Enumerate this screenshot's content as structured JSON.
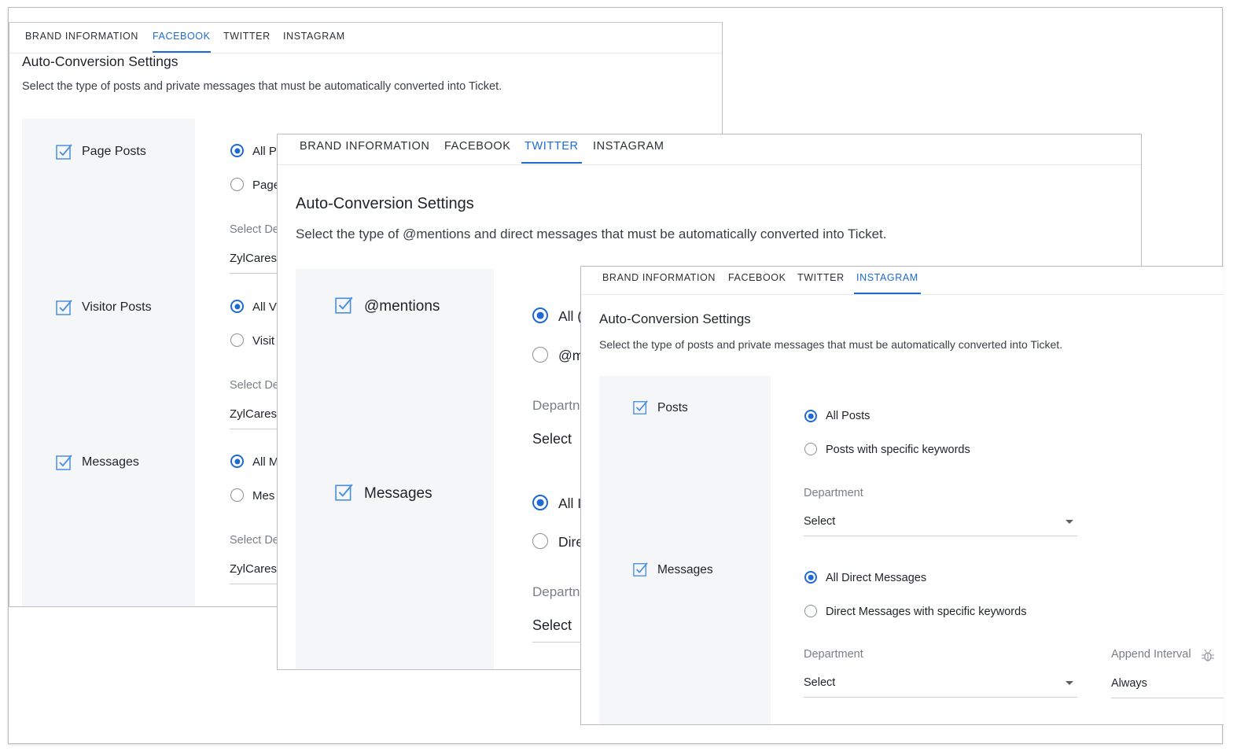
{
  "facebook_panel": {
    "tabs": [
      "BRAND INFORMATION",
      "FACEBOOK",
      "TWITTER",
      "INSTAGRAM"
    ],
    "active_tab": "FACEBOOK",
    "title": "Auto-Conversion Settings",
    "subtitle": "Select the type of posts and private messages that must be automatically converted into Ticket.",
    "sections": [
      {
        "label": "Page Posts",
        "options": [
          {
            "label": "All P",
            "selected": true
          },
          {
            "label": "Page",
            "selected": false
          }
        ],
        "field_label": "Select De",
        "field_value": "ZylCares"
      },
      {
        "label": "Visitor Posts",
        "options": [
          {
            "label": "All V",
            "selected": true
          },
          {
            "label": "Visit",
            "selected": false
          }
        ],
        "field_label": "Select De",
        "field_value": "ZylCares"
      },
      {
        "label": "Messages",
        "options": [
          {
            "label": "All M",
            "selected": true
          },
          {
            "label": "Mes",
            "selected": false
          }
        ],
        "field_label": "Select De",
        "field_value": "ZylCares"
      }
    ]
  },
  "twitter_panel": {
    "tabs": [
      "BRAND INFORMATION",
      "FACEBOOK",
      "TWITTER",
      "INSTAGRAM"
    ],
    "active_tab": "TWITTER",
    "title": "Auto-Conversion Settings",
    "subtitle": "Select the type of @mentions and direct messages that must be automatically converted into Ticket.",
    "sections": [
      {
        "label": "@mentions",
        "options": [
          {
            "label": "All (",
            "selected": true
          },
          {
            "label": "@m",
            "selected": false
          }
        ],
        "field_label": "Departn",
        "field_value": "Select"
      },
      {
        "label": "Messages",
        "options": [
          {
            "label": "All I",
            "selected": true
          },
          {
            "label": "Dire",
            "selected": false
          }
        ],
        "field_label": "Departn",
        "field_value": "Select"
      }
    ]
  },
  "instagram_panel": {
    "tabs": [
      "BRAND INFORMATION",
      "FACEBOOK",
      "TWITTER",
      "INSTAGRAM"
    ],
    "active_tab": "INSTAGRAM",
    "title": "Auto-Conversion Settings",
    "subtitle": "Select the type of posts and private messages that must be automatically converted into Ticket.",
    "sections": [
      {
        "label": "Posts",
        "options": [
          {
            "label": "All Posts",
            "selected": true
          },
          {
            "label": "Posts with specific keywords",
            "selected": false
          }
        ],
        "field_label": "Department",
        "field_value": "Select"
      },
      {
        "label": "Messages",
        "options": [
          {
            "label": "All Direct Messages",
            "selected": true
          },
          {
            "label": "Direct Messages with specific keywords",
            "selected": false
          }
        ],
        "field_label": "Department",
        "field_value": "Select",
        "extra_field_label": "Append Interval",
        "extra_field_value": "Always"
      }
    ]
  },
  "colors": {
    "accent": "#1e6ad4",
    "panel_border": "#b9bcc1",
    "left_column_bg": "#f5f6f8",
    "muted_text": "#7a7f86"
  },
  "icons": {
    "section_checkbox": "checked-checkbox-icon",
    "dropdown": "chevron-down-icon",
    "info": "bug-icon"
  }
}
